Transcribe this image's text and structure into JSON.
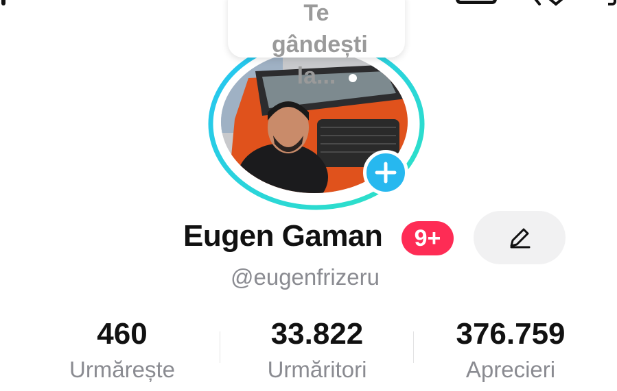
{
  "profile": {
    "display_name": "Eugen Gaman",
    "notification_badge": "9+",
    "username": "@eugenfrizeru",
    "thought_prompt": "Te gândești la..."
  },
  "stats": [
    {
      "value": "460",
      "label": "Urmărește"
    },
    {
      "value": "33.822",
      "label": "Urmăritori"
    },
    {
      "value": "376.759",
      "label": "Aprecieri"
    }
  ],
  "colors": {
    "accent": "#fe2c55",
    "add_button": "#27b8ef",
    "ring_start": "#25c3f4",
    "ring_end": "#2ee3c4",
    "secondary_text": "#8a8b91"
  },
  "icons": {
    "add": "plus-icon",
    "edit": "pencil-icon"
  }
}
